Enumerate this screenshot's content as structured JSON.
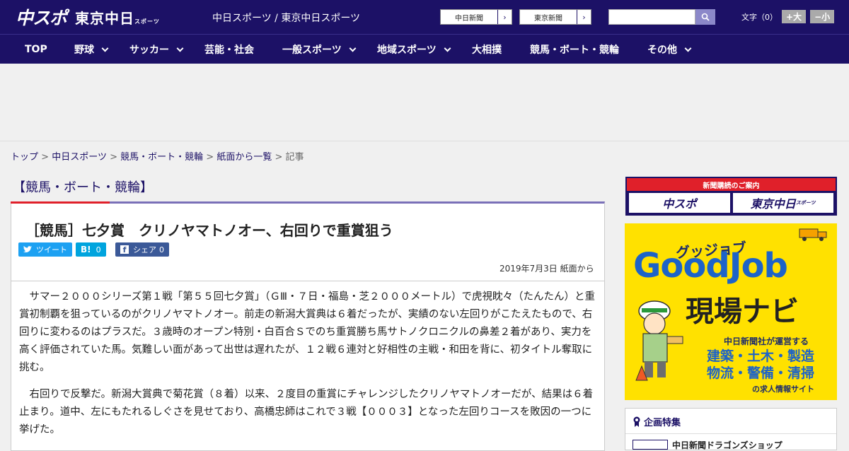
{
  "header": {
    "logo_main": "中スポ",
    "logo_tokyo": "東京中日",
    "logo_tokyo_small": "スポーツ",
    "site_title": "中日スポーツ / 東京中日スポーツ",
    "chunichi_btn": "中日新聞",
    "tokyo_btn": "東京新聞",
    "search_placeholder": "",
    "fontsize_label": "文字（0）",
    "fontsize_larger": "+大",
    "fontsize_smaller": "−小"
  },
  "nav": {
    "items": [
      {
        "label": "TOP"
      },
      {
        "label": "野球"
      },
      {
        "label": "サッカー"
      },
      {
        "label": "芸能・社会"
      },
      {
        "label": "一般スポーツ"
      },
      {
        "label": "地域スポーツ"
      },
      {
        "label": "大相撲"
      },
      {
        "label": "競馬・ボート・競輪"
      },
      {
        "label": "その他"
      }
    ]
  },
  "breadcrumb": {
    "items": [
      "トップ",
      "中日スポーツ",
      "競馬・ボート・競輪",
      "紙面から一覧"
    ],
    "current": "記事",
    "separator": ">"
  },
  "article": {
    "category": "【競馬・ボート・競輪】",
    "headline": "［競馬］七夕賞　クリノヤマトノオー、右回りで重賞狙う",
    "share_tweet": "ツイート",
    "share_hatena_icon": "B!",
    "share_hatena_count": "0",
    "share_facebook": "シェア",
    "share_facebook_count": "0",
    "date": "2019年7月3日 紙面から",
    "paragraphs": [
      "サマー２０００シリーズ第１戦「第５５回七夕賞」（ＧⅢ・７日・福島・芝２０００メートル）で虎視眈々（たんたん）と重賞初制覇を狙っているのがクリノヤマトノオー。前走の新潟大賞典は６着だったが、実績のない左回りがこたえたもので、右回りに変わるのはプラスだ。３歳時のオープン特別・白百合Ｓでのち重賞勝ち馬サトノクロニクルの鼻差２着があり、実力を高く評価されていた馬。気難しい面があって出世は遅れたが、１２戦６連対と好相性の主戦・和田を背に、初タイトル奪取に挑む。",
      "右回りで反撃だ。新潟大賞典で菊花賞（８着）以来、２度目の重賞にチャレンジしたクリノヤマトノオーだが、結果は６着止まり。道中、左にもたれるしぐさを見せており、高橋忠師はこれで３戦【０００３】となった左回りコースを敗因の一つに挙げた。"
    ]
  },
  "sidebar": {
    "subscription_banner_title": "新聞購読のご案内",
    "subscription_logo_1": "中スポ",
    "subscription_logo_2": "東京中日",
    "subscription_logo_2_small": "スポーツ",
    "goodjob_kana": "グッジョブ",
    "goodjob_title": "GoodJob",
    "goodjob_navi": "現場ナビ",
    "goodjob_sub": "中日新聞社が運営する",
    "goodjob_list_1": "建築・土木・製造",
    "goodjob_list_2": "物流・警備・清掃",
    "goodjob_foot": "の求人情報サイト",
    "feature_title": "企画特集",
    "feature_item": "中日新聞ドラゴンズショップ"
  },
  "colors": {
    "brand_navy": "#1c1166",
    "accent_red": "#e0202a",
    "twitter": "#1da1f2",
    "hatena": "#00a4de",
    "facebook": "#3b5998",
    "goodjob_yellow": "#ffe100",
    "goodjob_blue": "#1d63c8"
  },
  "icons": {
    "search": "search-icon",
    "twitter": "twitter-bird-icon",
    "facebook": "facebook-icon",
    "hatena": "hatena-bookmark-icon",
    "feature": "ribbon-icon"
  }
}
